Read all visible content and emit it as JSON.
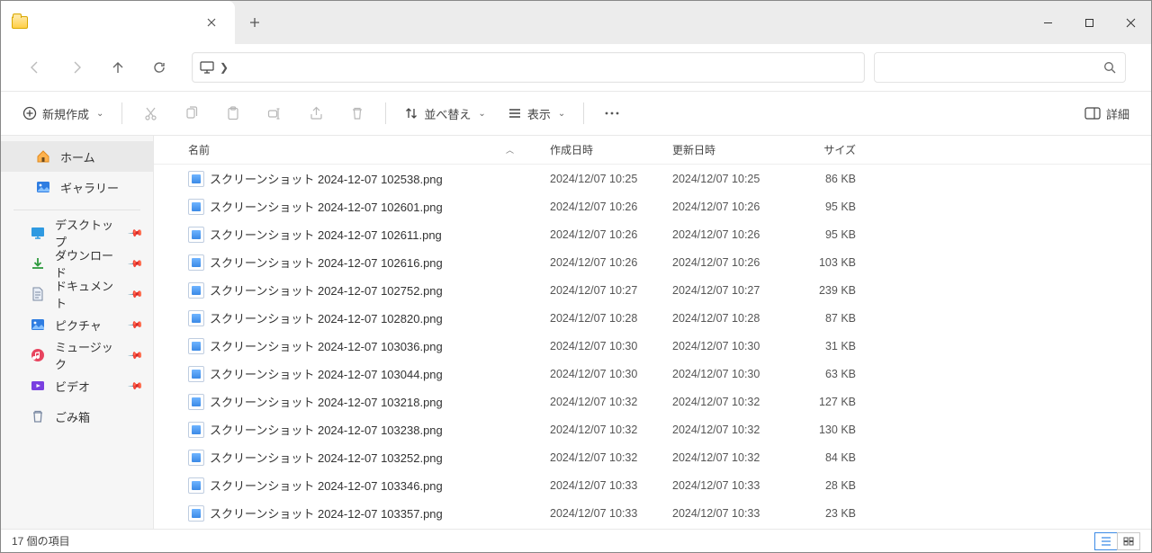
{
  "tab": {
    "title": ""
  },
  "toolbar": {
    "new": "新規作成",
    "sort": "並べ替え",
    "view": "表示",
    "details": "詳細"
  },
  "sidebar": {
    "top": [
      {
        "label": "ホーム",
        "icon": "home"
      },
      {
        "label": "ギャラリー",
        "icon": "gallery"
      }
    ],
    "quick": [
      {
        "label": "デスクトップ",
        "icon": "desktop"
      },
      {
        "label": "ダウンロード",
        "icon": "download"
      },
      {
        "label": "ドキュメント",
        "icon": "document"
      },
      {
        "label": "ピクチャ",
        "icon": "picture"
      },
      {
        "label": "ミュージック",
        "icon": "music"
      },
      {
        "label": "ビデオ",
        "icon": "video"
      },
      {
        "label": "ごみ箱",
        "icon": "trash"
      }
    ]
  },
  "columns": {
    "name": "名前",
    "created": "作成日時",
    "modified": "更新日時",
    "size": "サイズ"
  },
  "files": [
    {
      "name": "スクリーンショット 2024-12-07 102538.png",
      "created": "2024/12/07 10:25",
      "modified": "2024/12/07 10:25",
      "size": "86 KB"
    },
    {
      "name": "スクリーンショット 2024-12-07 102601.png",
      "created": "2024/12/07 10:26",
      "modified": "2024/12/07 10:26",
      "size": "95 KB"
    },
    {
      "name": "スクリーンショット 2024-12-07 102611.png",
      "created": "2024/12/07 10:26",
      "modified": "2024/12/07 10:26",
      "size": "95 KB"
    },
    {
      "name": "スクリーンショット 2024-12-07 102616.png",
      "created": "2024/12/07 10:26",
      "modified": "2024/12/07 10:26",
      "size": "103 KB"
    },
    {
      "name": "スクリーンショット 2024-12-07 102752.png",
      "created": "2024/12/07 10:27",
      "modified": "2024/12/07 10:27",
      "size": "239 KB"
    },
    {
      "name": "スクリーンショット 2024-12-07 102820.png",
      "created": "2024/12/07 10:28",
      "modified": "2024/12/07 10:28",
      "size": "87 KB"
    },
    {
      "name": "スクリーンショット 2024-12-07 103036.png",
      "created": "2024/12/07 10:30",
      "modified": "2024/12/07 10:30",
      "size": "31 KB"
    },
    {
      "name": "スクリーンショット 2024-12-07 103044.png",
      "created": "2024/12/07 10:30",
      "modified": "2024/12/07 10:30",
      "size": "63 KB"
    },
    {
      "name": "スクリーンショット 2024-12-07 103218.png",
      "created": "2024/12/07 10:32",
      "modified": "2024/12/07 10:32",
      "size": "127 KB"
    },
    {
      "name": "スクリーンショット 2024-12-07 103238.png",
      "created": "2024/12/07 10:32",
      "modified": "2024/12/07 10:32",
      "size": "130 KB"
    },
    {
      "name": "スクリーンショット 2024-12-07 103252.png",
      "created": "2024/12/07 10:32",
      "modified": "2024/12/07 10:32",
      "size": "84 KB"
    },
    {
      "name": "スクリーンショット 2024-12-07 103346.png",
      "created": "2024/12/07 10:33",
      "modified": "2024/12/07 10:33",
      "size": "28 KB"
    },
    {
      "name": "スクリーンショット 2024-12-07 103357.png",
      "created": "2024/12/07 10:33",
      "modified": "2024/12/07 10:33",
      "size": "23 KB"
    }
  ],
  "status": {
    "count": "17 個の項目"
  }
}
